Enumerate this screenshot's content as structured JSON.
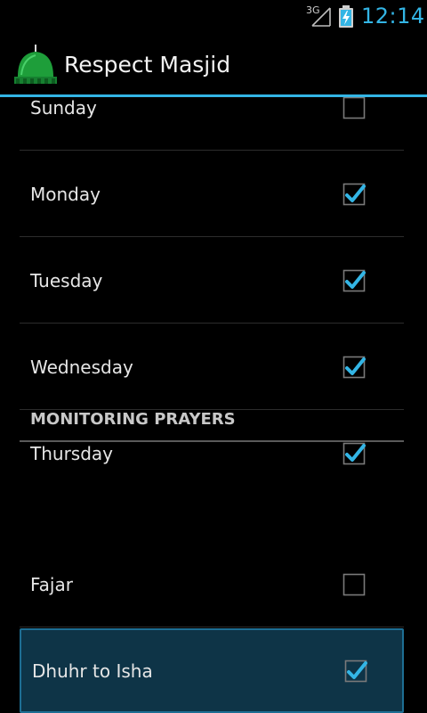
{
  "status_bar": {
    "network": "3G",
    "time": "12:14",
    "accent_color": "#33b5e5",
    "icons": [
      "signal-icon",
      "battery-charging-icon"
    ]
  },
  "action_bar": {
    "title": "Respect Masjid",
    "icon": "masjid-dome-icon"
  },
  "days": [
    {
      "label": "Sunday",
      "checked": false
    },
    {
      "label": "Monday",
      "checked": true
    },
    {
      "label": "Tuesday",
      "checked": true
    },
    {
      "label": "Wednesday",
      "checked": true
    },
    {
      "label": "Thursday",
      "checked": true
    }
  ],
  "monitoring": {
    "section_title": "MONITORING PRAYERS",
    "items": [
      {
        "label": "Fajar",
        "checked": false
      },
      {
        "label": "Dhuhr to Isha",
        "checked": true
      }
    ]
  }
}
